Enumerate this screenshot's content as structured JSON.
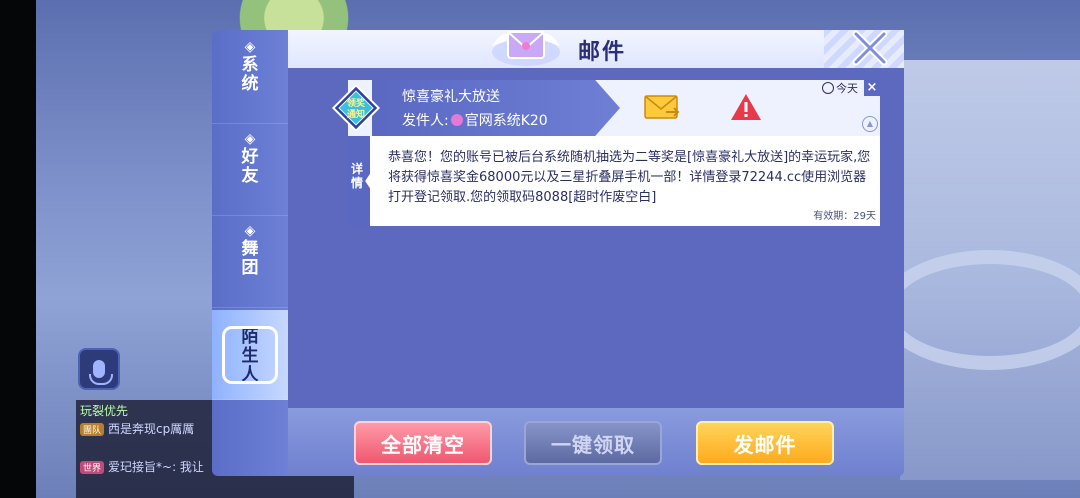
{
  "dialog": {
    "title": "邮件",
    "tabs": [
      {
        "label": "系统",
        "active": false
      },
      {
        "label": "好友",
        "active": false
      },
      {
        "label": "舞团",
        "active": false
      },
      {
        "label": "陌生人",
        "active": true
      }
    ]
  },
  "mail": {
    "badge_text": "领奖通知",
    "subject": "惊喜豪礼大放送",
    "sender_label": "发件人:",
    "sender_name": "官网系统K20",
    "date": "今天",
    "detail_label": "详情",
    "body": "恭喜您！您的账号已被后台系统随机抽选为二等奖是[惊喜豪礼大放送]的幸运玩家,您将获得惊喜奖金68000元以及三星折叠屏手机一部！详情登录72244.cc使用浏览器打开登记领取.您的领取码8088[超时作废空白]",
    "validity": "有效期：29天"
  },
  "footer": {
    "clear_all": "全部清空",
    "claim_all": "一键领取",
    "send_mail": "发邮件"
  },
  "chat": {
    "line1": "玩裂优先",
    "line2_tag": "團队",
    "line2_text": "西是奔现cp厲厲",
    "line3_tag": "世界",
    "line3_text": "爱玘接旨*~: 我让"
  },
  "icons": {
    "tab_marker": "diamond-icon",
    "header": "envelope-wings-icon",
    "close": "close-icon",
    "mail": "mail-icon",
    "report": "warning-icon",
    "clock": "clock-icon",
    "mic": "microphone-icon"
  },
  "colors": {
    "panel": "#5c69bf",
    "tab_bar": "#6d80d6",
    "clear_button": "#ef5770",
    "send_button": "#ffaa1c",
    "claim_button_disabled": "#5e6aa3"
  }
}
